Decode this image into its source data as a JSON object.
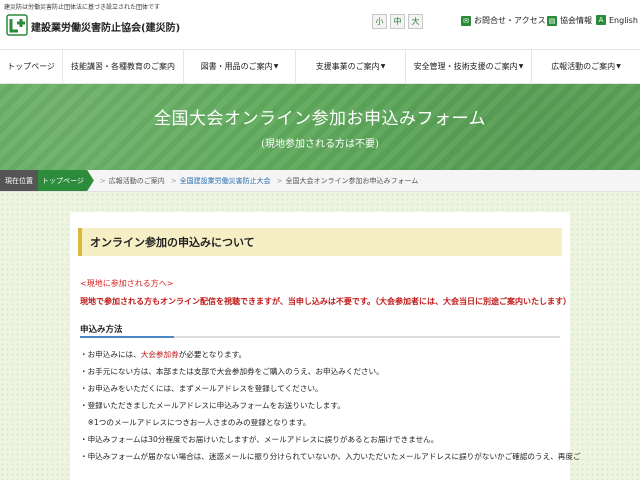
{
  "header": {
    "tagline": "建災防は労働災害防止団体法に基づき設立された団体です",
    "org_name": "建設業労働災害防止協会(建災防)",
    "font_sizes": [
      "小",
      "中",
      "大"
    ],
    "contact": "お問合せ・アクセス",
    "info": "協会情報",
    "english": "English",
    "english_icon": "A",
    "brand_color": "#2a8a3a"
  },
  "nav": {
    "items": [
      {
        "label": "トップページ",
        "arrow": ""
      },
      {
        "label": "技能講習・各種教育のご案内",
        "arrow": ""
      },
      {
        "label": "図書・用品のご案内",
        "arrow": "▼"
      },
      {
        "label": "支援事業のご案内",
        "arrow": "▼"
      },
      {
        "label": "安全管理・技術支援のご案内",
        "arrow": "▼"
      },
      {
        "label": "広報活動のご案内",
        "arrow": "▼"
      }
    ]
  },
  "hero": {
    "title": "全国大会オンライン参加お申込みフォーム",
    "subtitle": "(現地参加される方は不要)"
  },
  "breadcrumb": {
    "label": "現在位置",
    "home": "トップページ",
    "items": [
      "広報活動のご案内",
      "全国建設業労働災害防止大会",
      "全国大会オンライン参加お申込みフォーム"
    ]
  },
  "panel": {
    "heading": "オンライン参加の申込みについて",
    "notice_title": "<現地に参加される方へ>",
    "notice_body": "現地で参加される方もオンライン配信を視聴できますが、当申し込みは不要です。（大会参加者には、大会当日に別途ご案内いたします）",
    "method_title": "申込み方法",
    "list": [
      {
        "pre": "・お申込みには、",
        "hl": "大会参加券",
        "post": "が必要となります。"
      },
      {
        "pre": "・お手元にない方は、本部または支部で大会参加券をご購入のうえ、お申込みください。",
        "hl": "",
        "post": ""
      },
      {
        "pre": "・お申込みをいただくには、まずメールアドレスを登録してください。",
        "hl": "",
        "post": ""
      },
      {
        "pre": "・登録いただきましたメールアドレスに申込みフォームをお送りいたします。",
        "hl": "",
        "post": ""
      },
      {
        "pre": "　※1つのメールアドレスにつきお一人さまのみの登録となります。",
        "hl": "",
        "post": ""
      },
      {
        "pre": "・申込みフォームは30分程度でお届けいたしますが、メールアドレスに誤りがあるとお届けできません。",
        "hl": "",
        "post": ""
      },
      {
        "pre": "・申込みフォームが届かない場合は、迷惑メールに振り分けられていないか、入力いただいたメールアドレスに誤りがないかご確認のうえ、再度ご",
        "hl": "",
        "post": ""
      }
    ]
  }
}
